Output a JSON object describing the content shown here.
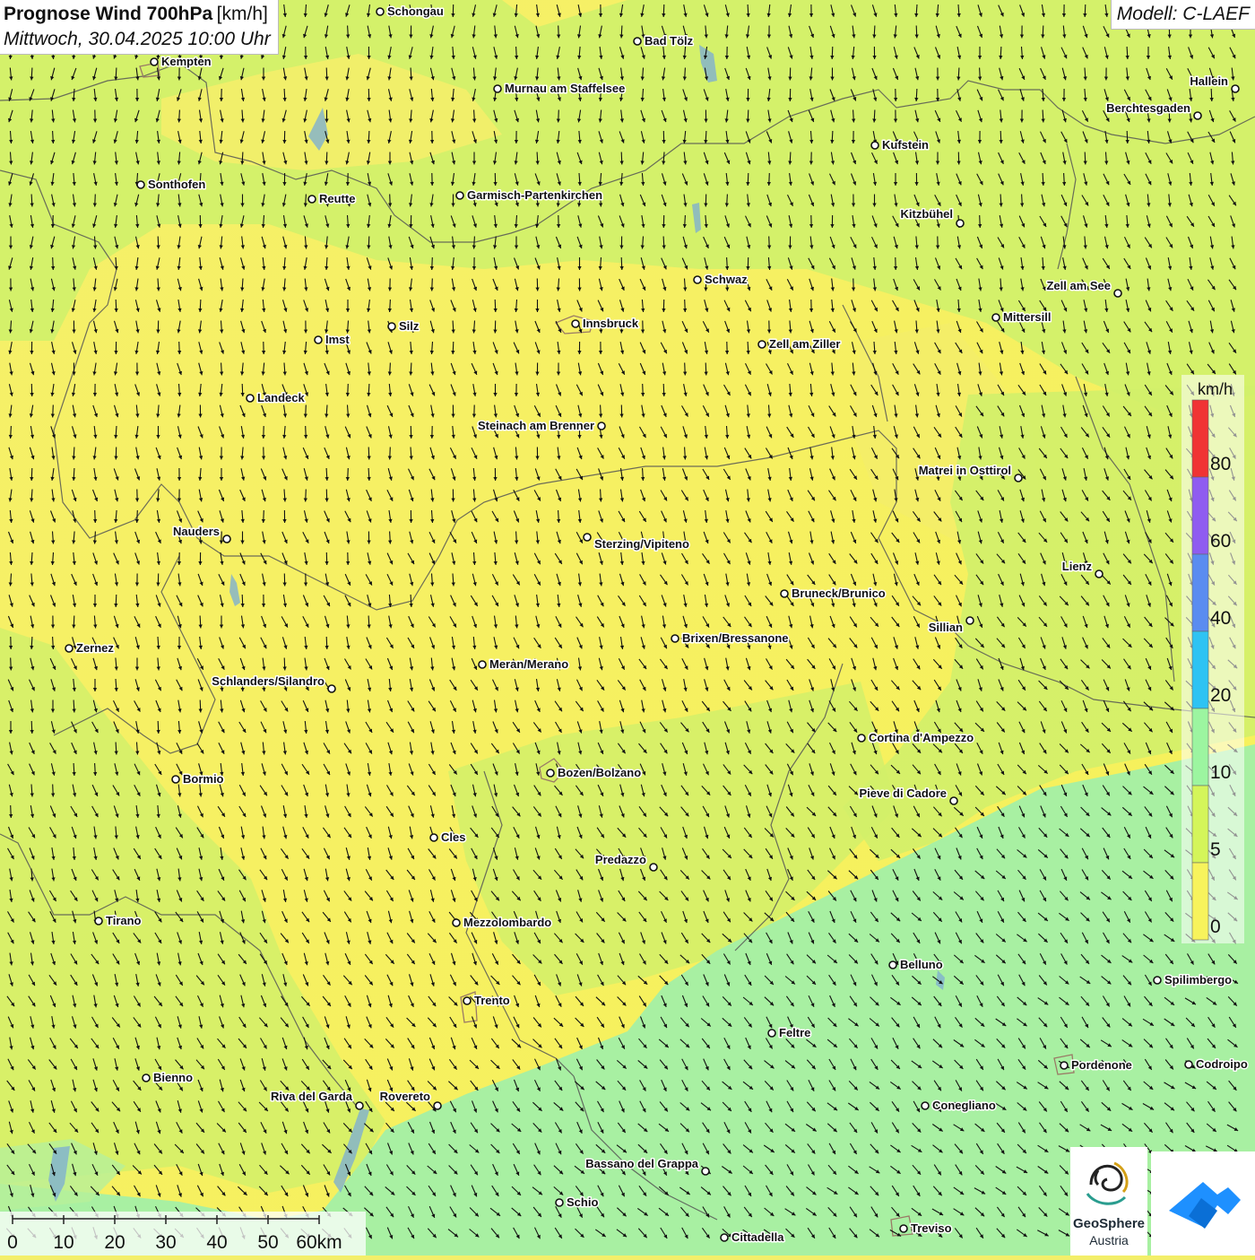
{
  "title": {
    "main": "Prognose Wind 700hPa",
    "unit": "[km/h]",
    "subtitle": "Mittwoch, 30.04.2025 10:00 Uhr"
  },
  "model": "Modell: C-LAEF",
  "legend": {
    "unit": "km/h",
    "ticks": [
      "80",
      "60",
      "40",
      "20",
      "10",
      "5",
      "0"
    ],
    "bands": [
      {
        "range": "0–5",
        "color": "#f7f35c"
      },
      {
        "range": "5–10",
        "color": "#d4f55a"
      },
      {
        "range": "10–20",
        "color": "#9cf5a0"
      },
      {
        "range": "20–40",
        "color": "#2ec3f3"
      },
      {
        "range": "40–60",
        "color": "#5a8cf0"
      },
      {
        "range": "60–80",
        "color": "#8f5cf0"
      },
      {
        "range": "80+",
        "color": "#f03434"
      }
    ]
  },
  "colors": {
    "calm": "#f7f35c",
    "light": "#cdf26a",
    "breeze": "#a8f0a0",
    "arrow": "#111111",
    "border": "#555555"
  },
  "wind": {
    "direction": "from north to north-east (arrows pointing south to south-west)",
    "general_speed_band": "0–10"
  },
  "cities": [
    {
      "name": "Schongau"
    },
    {
      "name": "Bad Tölz"
    },
    {
      "name": "Kempten"
    },
    {
      "name": "Murnau am Staffelsee"
    },
    {
      "name": "Hallein"
    },
    {
      "name": "Berchtesgaden"
    },
    {
      "name": "Kufstein"
    },
    {
      "name": "Sonthofen"
    },
    {
      "name": "Reutte"
    },
    {
      "name": "Garmisch-Partenkirchen"
    },
    {
      "name": "Kitzbühel"
    },
    {
      "name": "Schwaz"
    },
    {
      "name": "Zell am See"
    },
    {
      "name": "Mittersill"
    },
    {
      "name": "Innsbruck"
    },
    {
      "name": "Silz"
    },
    {
      "name": "Imst"
    },
    {
      "name": "Zell am Ziller"
    },
    {
      "name": "Landeck"
    },
    {
      "name": "Steinach am Brenner"
    },
    {
      "name": "Matrei in Osttirol"
    },
    {
      "name": "Nauders"
    },
    {
      "name": "Sterzing/Vipiteno"
    },
    {
      "name": "Lienz"
    },
    {
      "name": "Bruneck/Brunico"
    },
    {
      "name": "Sillian"
    },
    {
      "name": "Brixen/Bressanone"
    },
    {
      "name": "Zernez"
    },
    {
      "name": "Meran/Merano"
    },
    {
      "name": "Schlanders/Silandro"
    },
    {
      "name": "Cortina d'Ampezzo"
    },
    {
      "name": "Bozen/Bolzano"
    },
    {
      "name": "Bormio"
    },
    {
      "name": "Pieve di Cadore"
    },
    {
      "name": "Cles"
    },
    {
      "name": "Predazzo"
    },
    {
      "name": "Tirano"
    },
    {
      "name": "Mezzolombardo"
    },
    {
      "name": "Belluno"
    },
    {
      "name": "Spilimbergo"
    },
    {
      "name": "Trento"
    },
    {
      "name": "Feltre"
    },
    {
      "name": "Pordenone"
    },
    {
      "name": "Codroipo"
    },
    {
      "name": "Bienno"
    },
    {
      "name": "Riva del Garda"
    },
    {
      "name": "Rovereto"
    },
    {
      "name": "Conegliano"
    },
    {
      "name": "Bassano del Grappa"
    },
    {
      "name": "Schio"
    },
    {
      "name": "Treviso"
    },
    {
      "name": "Cittadella"
    }
  ],
  "scalebar": {
    "ticks": [
      "0",
      "10",
      "20",
      "30",
      "40",
      "50",
      "60km"
    ]
  },
  "logo": {
    "name": "GeoSphere",
    "sub": "Austria"
  }
}
